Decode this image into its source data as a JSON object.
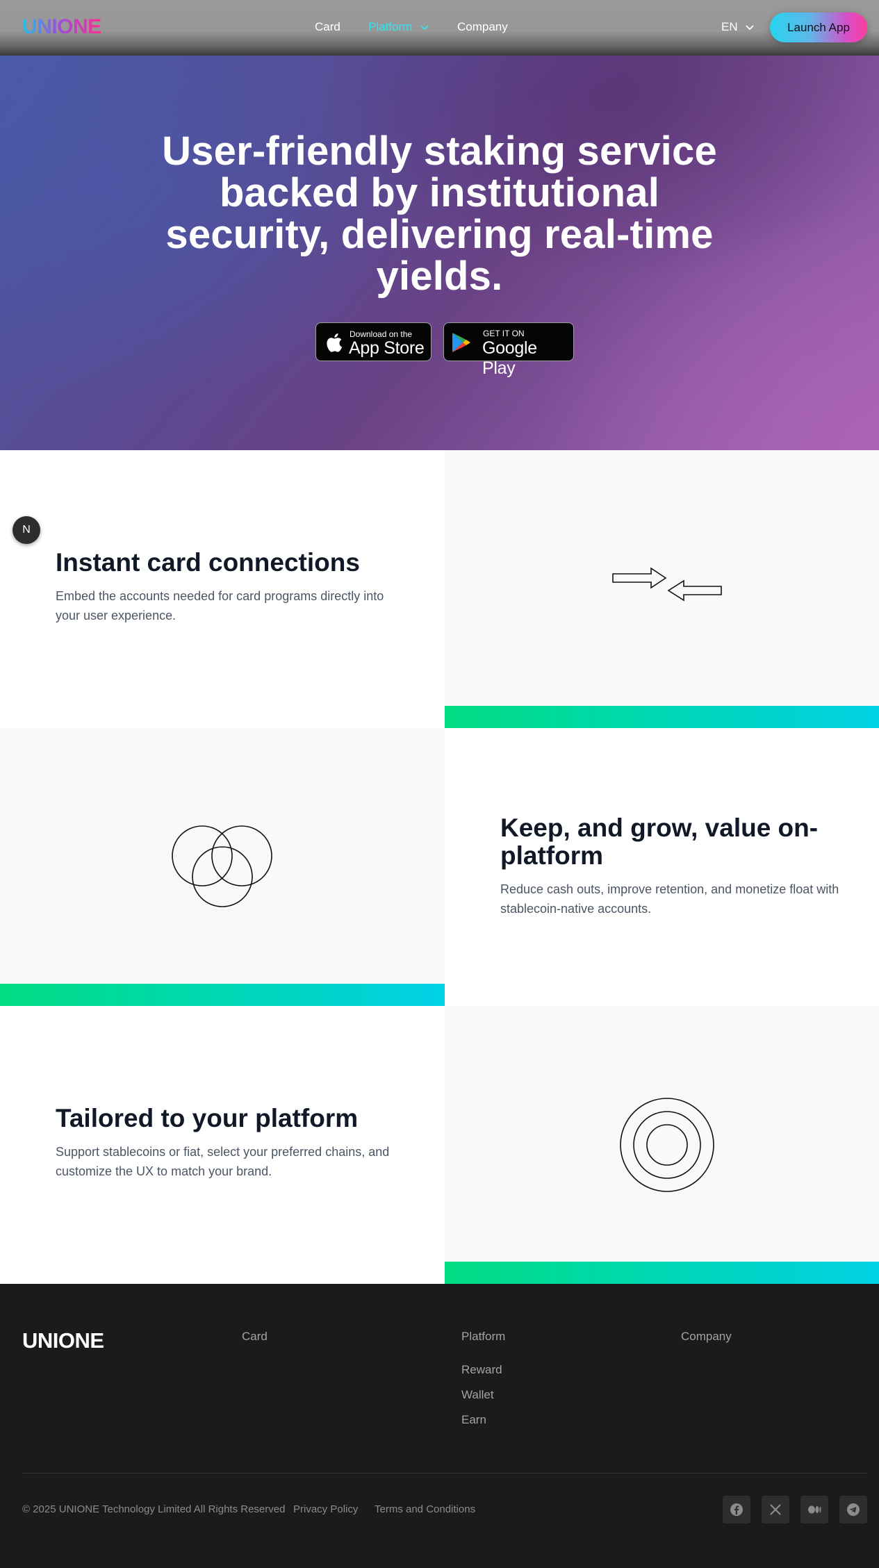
{
  "nav": {
    "logo": "UNIONE",
    "links": [
      {
        "label": "Card"
      },
      {
        "label": "Platform"
      },
      {
        "label": "Company"
      }
    ],
    "language": "EN",
    "launch_label": "Launch App",
    "active_color": "#2ee6f0"
  },
  "hero": {
    "title": "User-friendly staking service backed by institutional security, delivering real-time yields.",
    "app_store": {
      "small": "Download on the",
      "big": "App Store"
    },
    "google_play": {
      "small": "GET IT ON",
      "big": "Google Play"
    }
  },
  "badge": {
    "letter": "N"
  },
  "features": [
    {
      "title": "Instant card connections",
      "description": "Embed the accounts needed for card programs directly into your user experience.",
      "icon": "exchange-arrows-icon"
    },
    {
      "title": "Keep, and grow, value on-platform",
      "description": "Reduce cash outs, improve retention, and monetize float with stablecoin-native accounts.",
      "icon": "overlapping-circles-icon"
    },
    {
      "title": "Tailored to your platform",
      "description": "Support stablecoins or fiat, select your preferred chains, and customize the UX to match your brand.",
      "icon": "concentric-circles-icon"
    }
  ],
  "footer": {
    "logo": "UNIONE",
    "columns": [
      {
        "heading": "Card",
        "links": []
      },
      {
        "heading": "Platform",
        "links": [
          "Reward",
          "Wallet",
          "Earn"
        ]
      },
      {
        "heading": "Company",
        "links": []
      }
    ],
    "copyright": "© 2025 UNIONE Technology Limited All Rights Reserved",
    "privacy": "Privacy Policy",
    "terms": "Terms and Conditions",
    "social": [
      "facebook-icon",
      "x-icon",
      "medium-icon",
      "telegram-icon"
    ]
  },
  "colors": {
    "accent_gradient_start": "#00dc82",
    "accent_gradient_end": "#00d2e6",
    "footer_bg": "#1b1b1b"
  }
}
